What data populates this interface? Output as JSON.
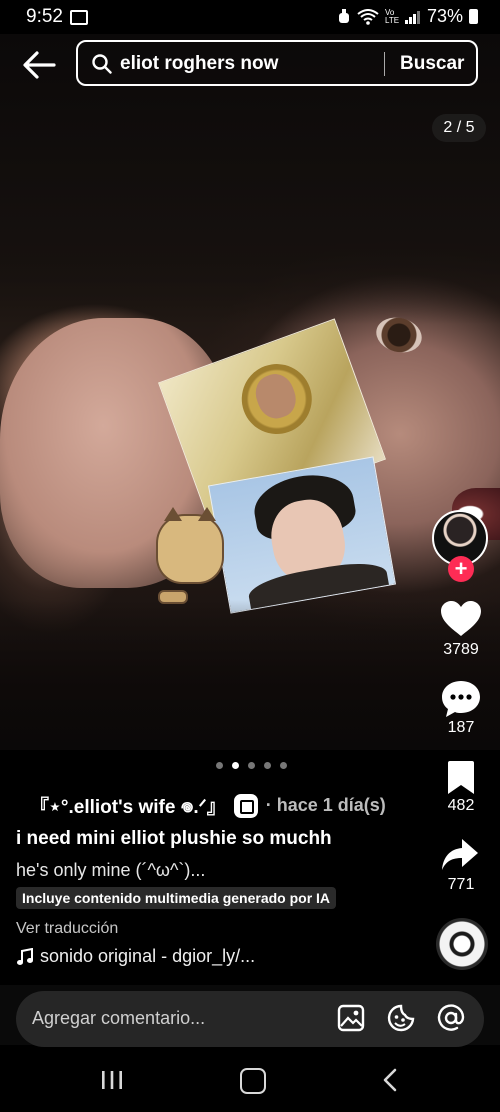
{
  "status_bar": {
    "time": "9:52",
    "signal_text": "Vo LTE",
    "battery": "73%"
  },
  "search": {
    "query": "eliot roghers now",
    "button_label": "Buscar"
  },
  "media": {
    "page_counter": "2 / 5",
    "carousel_total": 5,
    "carousel_active": 2
  },
  "actions": {
    "likes": "3789",
    "comments": "187",
    "saves": "482",
    "shares": "771"
  },
  "post": {
    "author": "『⋆°.elliot's wife 𖦹.ᐟ』",
    "timestamp": "· hace 1 día(s)",
    "title": "i need mini elliot plushie so muchh",
    "body": "he's only mine (´^ω^`)...",
    "ai_label": "Incluye contenido multimedia generado por IA",
    "translate": "Ver traducción",
    "sound": "sonido original - dgior_ly/..."
  },
  "comment_bar": {
    "placeholder": "Agregar comentario..."
  },
  "colors": {
    "accent": "#fe2c55",
    "background": "#000000"
  }
}
